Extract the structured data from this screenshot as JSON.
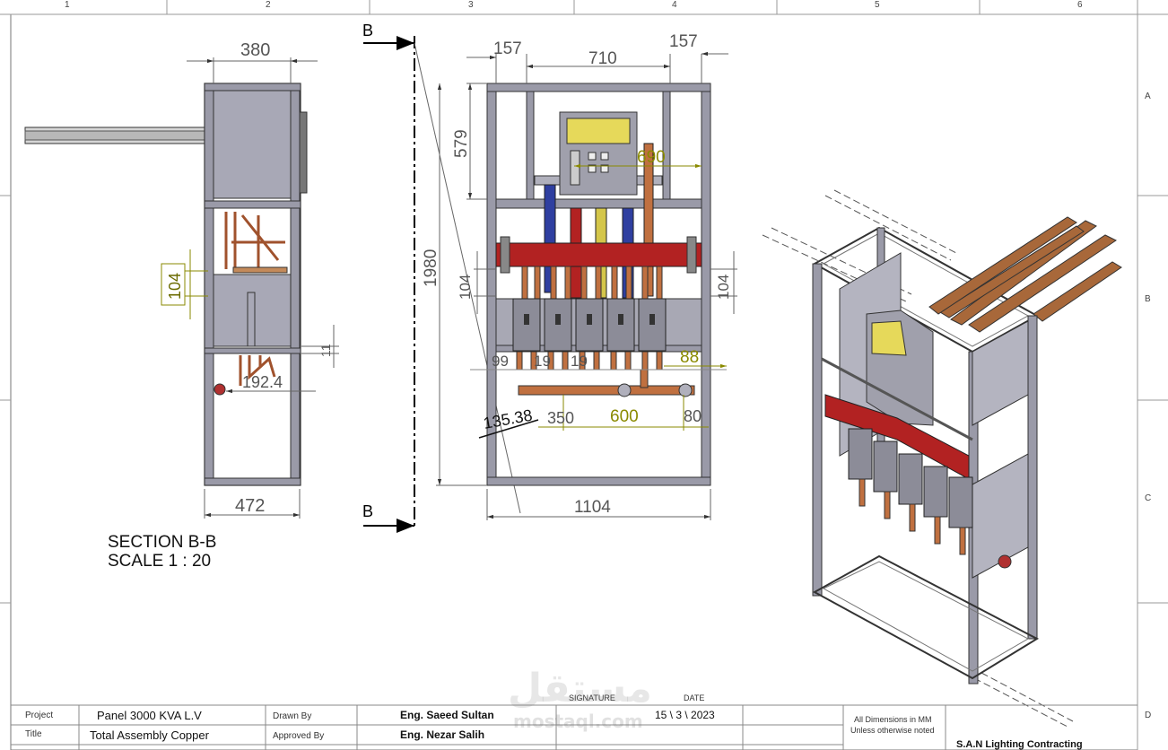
{
  "border": {
    "columns": [
      "1",
      "2",
      "3",
      "4",
      "5",
      "6"
    ],
    "rows": [
      "A",
      "B",
      "C",
      "D"
    ]
  },
  "section_view": {
    "marker": "B",
    "title": "SECTION B-B",
    "scale": "SCALE 1 : 20",
    "dims": {
      "top_width": "380",
      "bottom_width": "472",
      "busbar_height": "104",
      "gap": "11",
      "offset": "192.4"
    }
  },
  "front_view": {
    "dims": {
      "left_margin": "157",
      "center": "710",
      "right_margin": "157",
      "upper_height": "579",
      "inner_width": "690",
      "overall_height": "1980",
      "left_busbar": "104",
      "right_busbar": "104",
      "d1": "99",
      "d2": "19",
      "d3": "19",
      "d4": "88",
      "angle": "135.38",
      "d5": "350",
      "d6": "600",
      "d7": "80",
      "overall_width": "1104"
    }
  },
  "title_block": {
    "project_label": "Project",
    "project_value": "Panel 3000 KVA L.V",
    "title_label": "Title",
    "title_value": "Total Assembly Copper",
    "drawn_label": "Drawn By",
    "drawn_value": "Eng. Saeed Sultan",
    "approved_label": "Approved By",
    "approved_value": "Eng. Nezar Salih",
    "signature_label": "SIGNATURE",
    "date_label": "DATE",
    "date_value": "15 \\ 3 \\ 2023",
    "dims_note_1": "All Dimensions in MM",
    "dims_note_2": "Unless otherwise noted",
    "company": "S.A.N Lighting Contracting"
  },
  "watermark": {
    "arabic": "مستقل",
    "latin": "mostaql.com"
  }
}
